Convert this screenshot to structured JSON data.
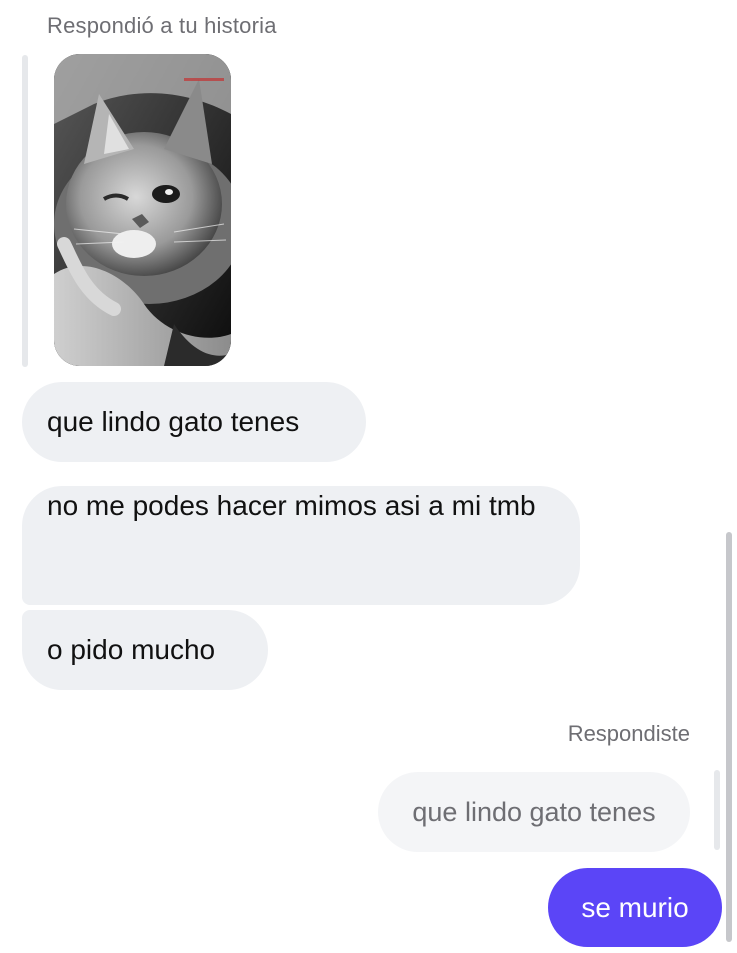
{
  "story": {
    "caption": "Respondió a tu historia",
    "image": "cat-photo"
  },
  "messages": {
    "incoming": [
      {
        "text": "que lindo gato tenes"
      },
      {
        "text": "no me podes hacer mimos asi a mi tmb"
      },
      {
        "text": "o pido mucho"
      }
    ],
    "reply": {
      "caption": "Respondiste",
      "quoted": "que lindo gato tenes"
    },
    "outgoing": [
      {
        "text": "se murio"
      }
    ]
  },
  "colors": {
    "incoming_bubble": "#eef0f3",
    "outgoing_bubble": "#5b45f7",
    "meta_text": "#6e6e73"
  }
}
